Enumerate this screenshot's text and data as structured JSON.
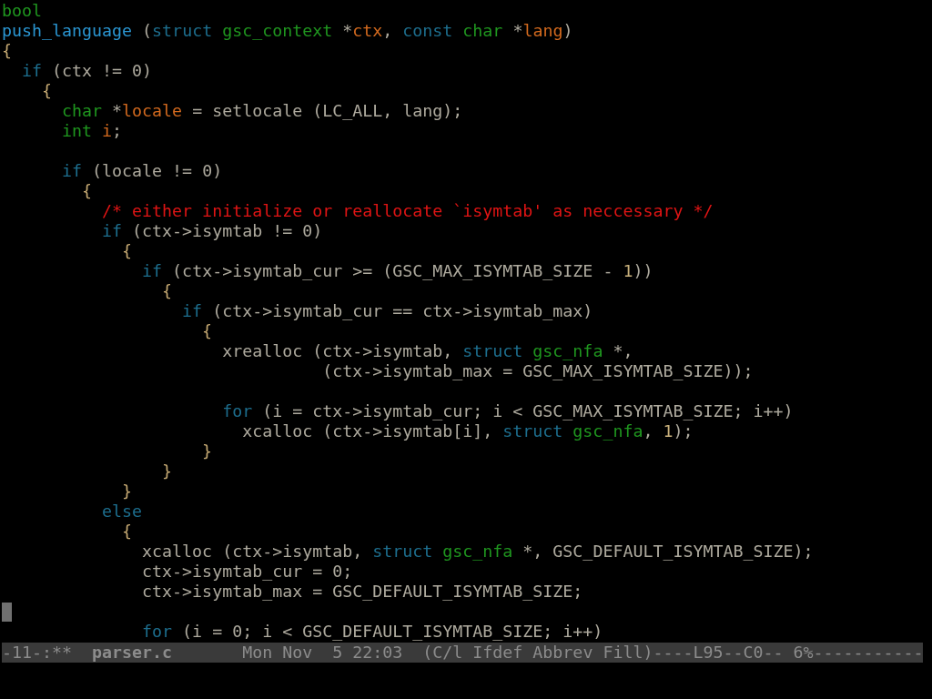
{
  "lines": [
    {
      "cursor": false,
      "segments": [
        {
          "kind": "type",
          "text": "bool"
        }
      ]
    },
    {
      "cursor": false,
      "segments": [
        {
          "kind": "fn",
          "text": "push_language"
        },
        {
          "kind": "plain",
          "text": " ("
        },
        {
          "kind": "kw",
          "text": "struct "
        },
        {
          "kind": "type",
          "text": "gsc_context"
        },
        {
          "kind": "plain",
          "text": " *"
        },
        {
          "kind": "var",
          "text": "ctx"
        },
        {
          "kind": "plain",
          "text": ", "
        },
        {
          "kind": "kw",
          "text": "const "
        },
        {
          "kind": "type",
          "text": "char"
        },
        {
          "kind": "plain",
          "text": " *"
        },
        {
          "kind": "var",
          "text": "lang"
        },
        {
          "kind": "plain",
          "text": ")"
        }
      ]
    },
    {
      "cursor": false,
      "segments": [
        {
          "kind": "brace",
          "text": "{"
        }
      ]
    },
    {
      "cursor": false,
      "segments": [
        {
          "kind": "kw",
          "text": "  if"
        },
        {
          "kind": "plain",
          "text": " (ctx != 0)"
        }
      ]
    },
    {
      "cursor": false,
      "segments": [
        {
          "kind": "brace",
          "text": "    {"
        }
      ]
    },
    {
      "cursor": false,
      "segments": [
        {
          "kind": "type",
          "text": "      char"
        },
        {
          "kind": "plain",
          "text": " *"
        },
        {
          "kind": "var",
          "text": "locale"
        },
        {
          "kind": "plain",
          "text": " = setlocale (LC_ALL, lang);"
        }
      ]
    },
    {
      "cursor": false,
      "segments": [
        {
          "kind": "type",
          "text": "      int "
        },
        {
          "kind": "var",
          "text": "i"
        },
        {
          "kind": "plain",
          "text": ";"
        }
      ]
    },
    {
      "cursor": false
    },
    {
      "cursor": false,
      "segments": [
        {
          "kind": "kw",
          "text": "      if"
        },
        {
          "kind": "plain",
          "text": " (locale != 0)"
        }
      ]
    },
    {
      "cursor": false,
      "segments": [
        {
          "kind": "brace",
          "text": "        {"
        }
      ]
    },
    {
      "cursor": false,
      "segments": [
        {
          "kind": "comment",
          "text": "          /* either initialize or reallocate `isymtab' as neccessary */"
        }
      ]
    },
    {
      "cursor": false,
      "segments": [
        {
          "kind": "kw",
          "text": "          if"
        },
        {
          "kind": "plain",
          "text": " (ctx->isymtab != 0)"
        }
      ]
    },
    {
      "cursor": false,
      "segments": [
        {
          "kind": "brace",
          "text": "            {"
        }
      ]
    },
    {
      "cursor": false,
      "segments": [
        {
          "kind": "kw",
          "text": "              if"
        },
        {
          "kind": "plain",
          "text": " (ctx->isymtab_cur >= (GSC_MAX_ISYMTAB_SIZE - "
        },
        {
          "kind": "num",
          "text": "1"
        },
        {
          "kind": "plain",
          "text": "))"
        }
      ]
    },
    {
      "cursor": false,
      "segments": [
        {
          "kind": "brace",
          "text": "                {"
        }
      ]
    },
    {
      "cursor": false,
      "segments": [
        {
          "kind": "kw",
          "text": "                  if"
        },
        {
          "kind": "plain",
          "text": " (ctx->isymtab_cur == ctx->isymtab_max)"
        }
      ]
    },
    {
      "cursor": false,
      "segments": [
        {
          "kind": "brace",
          "text": "                    {"
        }
      ]
    },
    {
      "cursor": false,
      "segments": [
        {
          "kind": "plain",
          "text": "                      xrealloc (ctx->isymtab, "
        },
        {
          "kind": "kw",
          "text": "struct "
        },
        {
          "kind": "type",
          "text": "gsc_nfa"
        },
        {
          "kind": "plain",
          "text": " *,"
        }
      ]
    },
    {
      "cursor": false,
      "segments": [
        {
          "kind": "plain",
          "text": "                                (ctx->isymtab_max = GSC_MAX_ISYMTAB_SIZE));"
        }
      ]
    },
    {
      "cursor": false
    },
    {
      "cursor": false,
      "segments": [
        {
          "kind": "kw",
          "text": "                      for"
        },
        {
          "kind": "plain",
          "text": " (i = ctx->isymtab_cur; i < GSC_MAX_ISYMTAB_SIZE; i++)"
        }
      ]
    },
    {
      "cursor": false,
      "segments": [
        {
          "kind": "plain",
          "text": "                        xcalloc (ctx->isymtab[i], "
        },
        {
          "kind": "kw",
          "text": "struct "
        },
        {
          "kind": "type",
          "text": "gsc_nfa"
        },
        {
          "kind": "plain",
          "text": ", "
        },
        {
          "kind": "num",
          "text": "1"
        },
        {
          "kind": "plain",
          "text": ");"
        }
      ]
    },
    {
      "cursor": false,
      "segments": [
        {
          "kind": "brace",
          "text": "                    }"
        }
      ]
    },
    {
      "cursor": false,
      "segments": [
        {
          "kind": "brace",
          "text": "                }"
        }
      ]
    },
    {
      "cursor": false,
      "segments": [
        {
          "kind": "brace",
          "text": "            }"
        }
      ]
    },
    {
      "cursor": false,
      "segments": [
        {
          "kind": "kw",
          "text": "          else"
        }
      ]
    },
    {
      "cursor": false,
      "segments": [
        {
          "kind": "brace",
          "text": "            {"
        }
      ]
    },
    {
      "cursor": false,
      "segments": [
        {
          "kind": "plain",
          "text": "              xcalloc (ctx->isymtab, "
        },
        {
          "kind": "kw",
          "text": "struct "
        },
        {
          "kind": "type",
          "text": "gsc_nfa"
        },
        {
          "kind": "plain",
          "text": " *, GSC_DEFAULT_ISYMTAB_SIZE);"
        }
      ]
    },
    {
      "cursor": false,
      "segments": [
        {
          "kind": "plain",
          "text": "              ctx->isymtab_cur = 0;"
        }
      ]
    },
    {
      "cursor": false,
      "segments": [
        {
          "kind": "plain",
          "text": "              ctx->isymtab_max = GSC_DEFAULT_ISYMTAB_SIZE;"
        }
      ]
    },
    {
      "cursor": true
    },
    {
      "cursor": false,
      "segments": [
        {
          "kind": "kw",
          "text": "              for"
        },
        {
          "kind": "plain",
          "text": " (i = 0; i < GSC_DEFAULT_ISYMTAB_SIZE; i++)"
        }
      ]
    }
  ],
  "mode_line": "-11-:**  **parser.c**       Mon Nov  5 22:03  (C/l Ifdef Abbrev Fill)----L95--C0-- 6%-----------"
}
